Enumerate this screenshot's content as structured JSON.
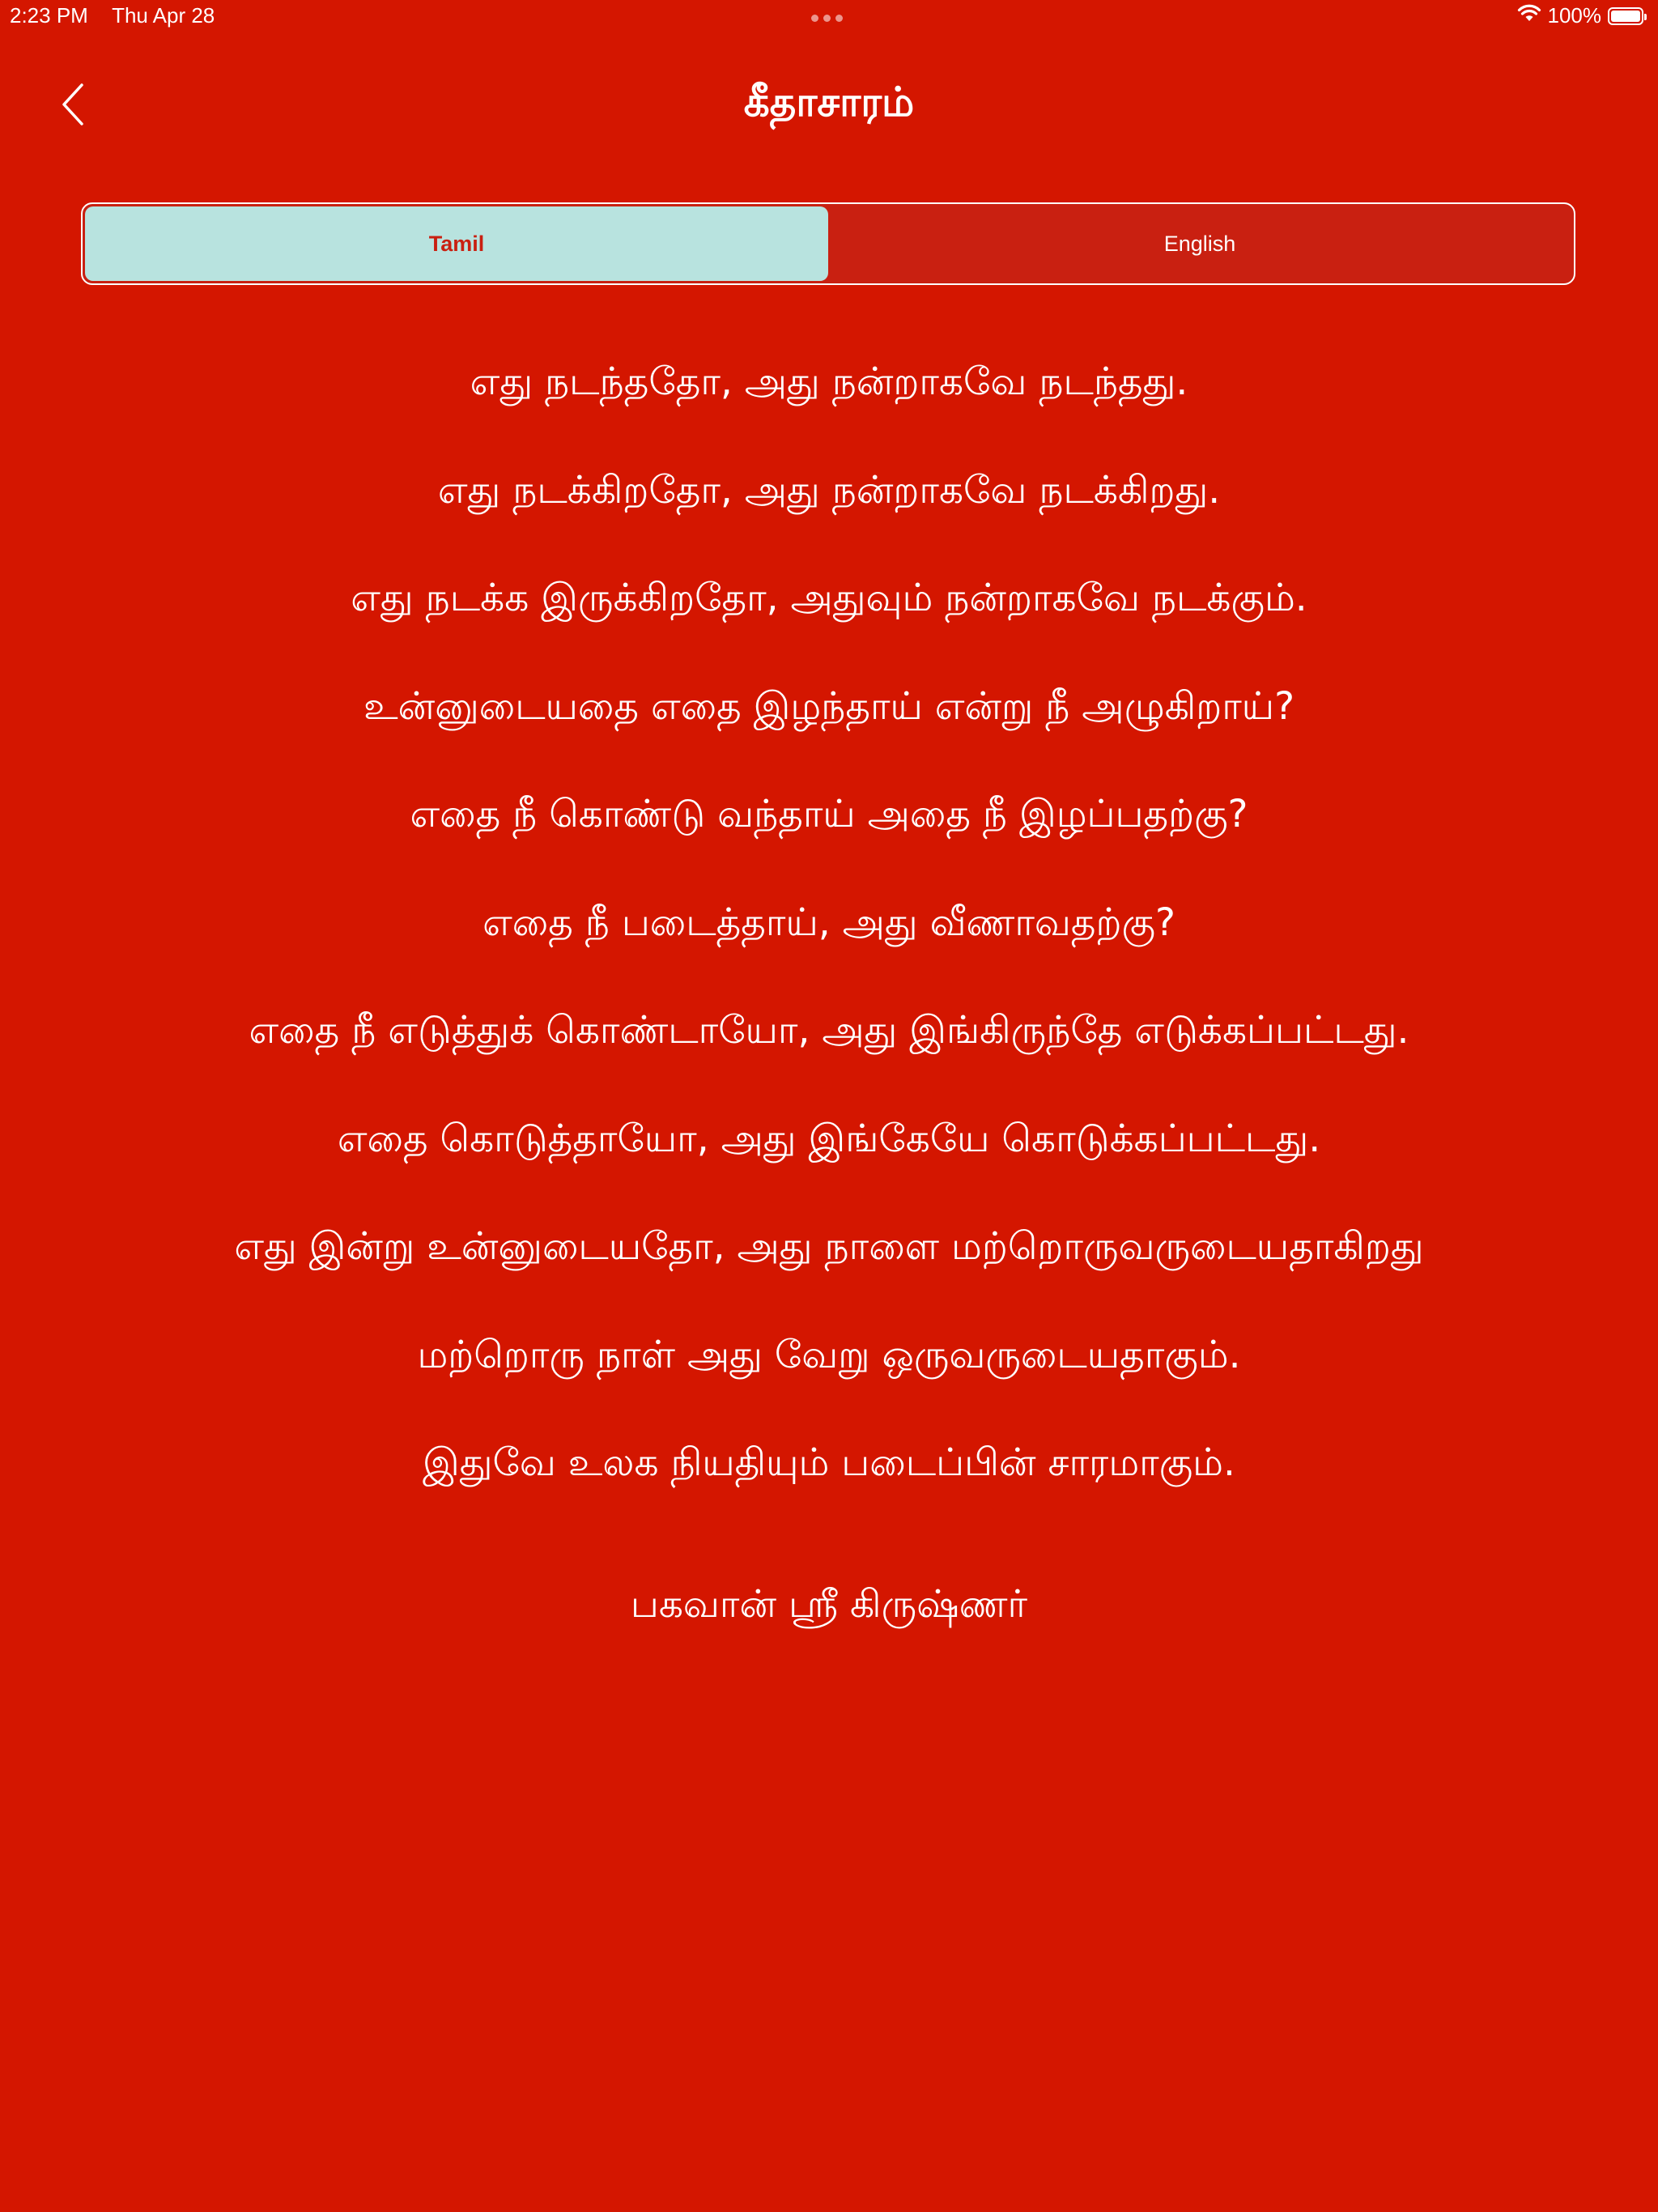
{
  "status_bar": {
    "time": "2:23 PM",
    "date": "Thu Apr 28",
    "battery_text": "100%",
    "battery_level": 1.0
  },
  "nav": {
    "title": "கீதாசாரம்",
    "back_icon": "chevron-left-icon"
  },
  "language_toggle": {
    "options": [
      "Tamil",
      "English"
    ],
    "selected": "Tamil"
  },
  "verses": [
    "எது நடந்ததோ, அது நன்றாகவே நடந்தது.",
    "எது நடக்கிறதோ, அது நன்றாகவே நடக்கிறது.",
    "எது நடக்க இருக்கிறதோ, அதுவும் நன்றாகவே நடக்கும்.",
    "உன்னுடையதை எதை இழந்தாய் என்று நீ அழுகிறாய்?",
    "எதை நீ கொண்டு வந்தாய் அதை நீ இழப்பதற்கு?",
    "எதை நீ படைத்தாய், அது வீணாவதற்கு?",
    "எதை நீ எடுத்துக் கொண்டாயோ, அது இங்கிருந்தே எடுக்கப்பட்டது.",
    "எதை கொடுத்தாயோ, அது இங்கேயே கொடுக்கப்பட்டது.",
    "எது இன்று உன்னுடையதோ, அது நாளை மற்றொருவருடையதாகிறது",
    "மற்றொரு நாள் அது வேறு ஒருவருடையதாகும்.",
    "இதுவே உலக நியதியும் படைப்பின் சாரமாகும்."
  ],
  "author": "பகவான் ஸ்ரீ கிருஷ்ணர்",
  "colors": {
    "background": "#d41600",
    "segment_selected_bg": "#b8e3df",
    "segment_unselected_bg": "#c92011",
    "text": "#ffffff"
  }
}
